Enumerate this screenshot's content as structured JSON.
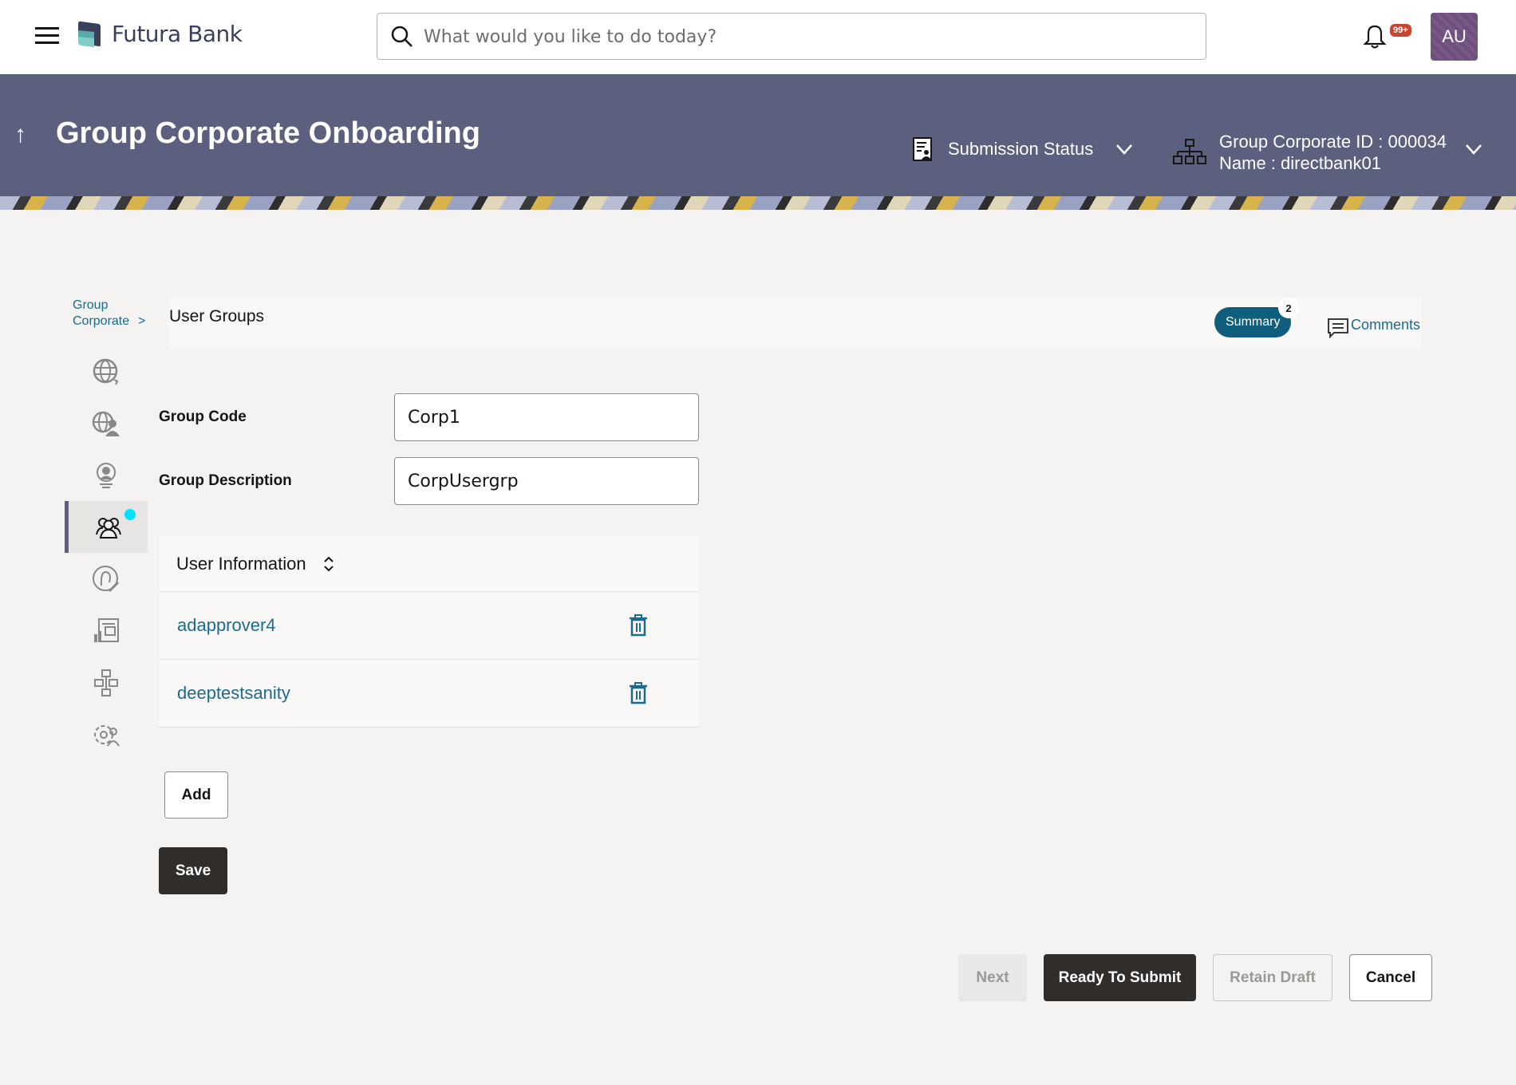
{
  "header": {
    "brand": "Futura Bank",
    "search_placeholder": "What would you like to do today?",
    "notifications_badge": "99+",
    "avatar_initials": "AU"
  },
  "banner": {
    "title": "Group Corporate Onboarding",
    "submission_status_label": "Submission Status",
    "group_corporate_id": "Group Corporate ID : 000034",
    "name": "Name : directbank01"
  },
  "breadcrumb": {
    "line1": "Group",
    "line2": "Corporate",
    "separator": ">"
  },
  "section": {
    "title": "User Groups",
    "summary_label": "Summary",
    "summary_count": "2",
    "comments_label": "Comments"
  },
  "sidenav": {
    "items": [
      {
        "icon": "globe-refresh-icon",
        "active": false
      },
      {
        "icon": "globe-user-icon",
        "active": false
      },
      {
        "icon": "user-profile-icon",
        "active": false
      },
      {
        "icon": "user-group-icon",
        "active": true
      },
      {
        "icon": "user-edit-icon",
        "active": false
      },
      {
        "icon": "report-icon",
        "active": false
      },
      {
        "icon": "workflow-icon",
        "active": false
      },
      {
        "icon": "settings-user-icon",
        "active": false
      }
    ]
  },
  "form": {
    "group_code_label": "Group Code",
    "group_code_value": "Corp1",
    "group_description_label": "Group Description",
    "group_description_value": "CorpUsergrp"
  },
  "user_table": {
    "header": "User Information",
    "users": [
      "adapprover4",
      "deeptestsanity"
    ]
  },
  "buttons": {
    "add": "Add",
    "save": "Save",
    "next": "Next",
    "ready_to_submit": "Ready To Submit",
    "retain_draft": "Retain Draft",
    "cancel": "Cancel"
  },
  "colors": {
    "banner": "#5a607e",
    "link": "#1b6b8c",
    "primary_dark": "#312d2a",
    "summary": "#0f5e7d",
    "notification": "#c74634",
    "active_dot": "#00e0ff"
  }
}
